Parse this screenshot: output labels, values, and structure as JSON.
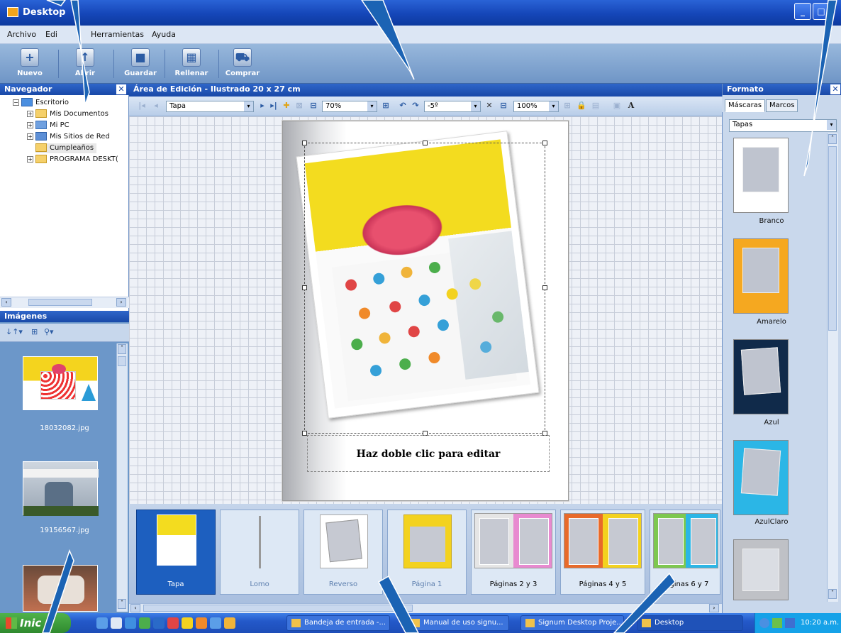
{
  "window": {
    "title": "Desktop"
  },
  "menu": [
    "Archivo",
    "Edi",
    "Herramientas",
    "Ayuda"
  ],
  "toolbar": {
    "buttons": [
      "Nuevo",
      "Abrir",
      "Guardar",
      "Rellenar",
      "Comprar"
    ]
  },
  "navigator": {
    "title": "Navegador",
    "items": [
      "Escritorio",
      "Mis Documentos",
      "Mi PC",
      "Mis Sitios de Red",
      "Cumpleaños",
      "PROGRAMA DESKT("
    ]
  },
  "images": {
    "title": "Imágenes",
    "files": [
      "18032082.jpg",
      "19156567.jpg"
    ]
  },
  "editor": {
    "title": "Área de Edición - Ilustrado 20 x 27 cm",
    "page_select": "Tapa",
    "zoom": "70%",
    "rotation": "-5º",
    "scale": "100%",
    "caption": "Haz doble clic para editar"
  },
  "pages": [
    "Tapa",
    "Lomo",
    "Reverso",
    "Página 1",
    "Páginas 2 y 3",
    "Páginas 4 y 5",
    "Páginas 6 y 7"
  ],
  "format": {
    "title": "Formato",
    "tabs": [
      "Máscaras",
      "Marcos"
    ],
    "category": "Tapas",
    "masks": [
      {
        "name": "Branco",
        "color": "#ffffff"
      },
      {
        "name": "Amarelo",
        "color": "#f5a820"
      },
      {
        "name": "Azul",
        "color": "#102a4a"
      },
      {
        "name": "AzulClaro",
        "color": "#2bb6e6"
      }
    ]
  },
  "taskbar": {
    "start": "Inic",
    "tasks": [
      "Bandeja de entrada -...",
      "Manual de uso signu...",
      "Signum Desktop Proje...",
      "Desktop"
    ],
    "clock": "10:20 a.m."
  }
}
